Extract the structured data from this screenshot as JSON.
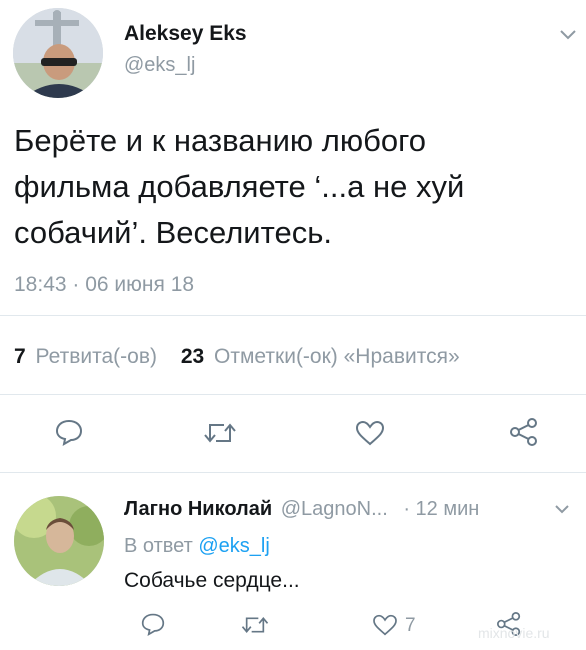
{
  "tweet": {
    "author_name": "Aleksey Eks",
    "author_handle": "@eks_lj",
    "text_line1": "Берёте и к названию любого",
    "text_line2": "фильма добавляете ‘...а не хуй",
    "text_line3": "собачий’. Веселитесь.",
    "timestamp": "18:43 · 06 июня 18",
    "retweet_count": "7",
    "retweet_label": "Ретвита(-ов)",
    "like_count": "23",
    "like_label": "Отметки(-ок) «Нравится»"
  },
  "reply": {
    "author_name": "Лагно Николай",
    "author_handle": "@LagnoN...",
    "time": "· 12 мин",
    "in_reply_prefix": "В ответ",
    "in_reply_handle": "@eks_lj",
    "text": "Собачье сердце...",
    "like_count": "7"
  },
  "watermark": "mixnovie.ru",
  "icons": [
    "chevron-down-icon",
    "reply-icon",
    "retweet-icon",
    "heart-icon",
    "share-icon"
  ],
  "colors": {
    "text": "#14171a",
    "muted": "#8f9aa3",
    "link": "#1da1f2",
    "divider": "#e1e8ed"
  }
}
